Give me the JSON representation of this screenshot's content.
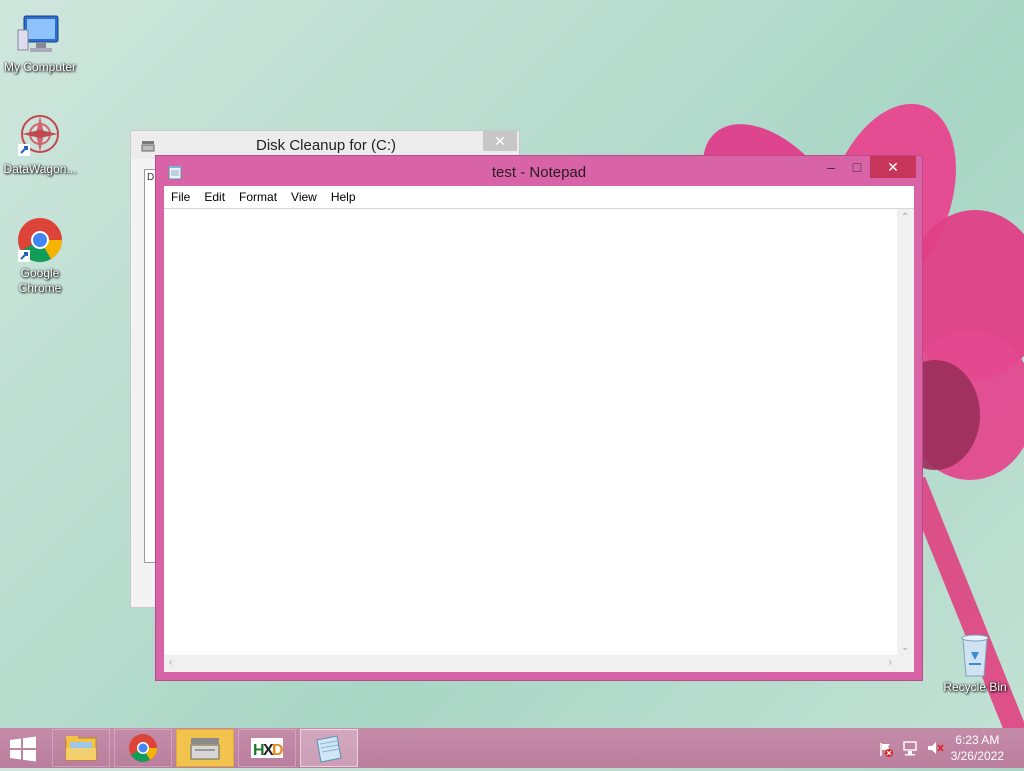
{
  "desktop": {
    "icons": [
      {
        "label": "My Computer",
        "icon": "computer-icon"
      },
      {
        "label": "DataWagon...",
        "icon": "datawagon-icon"
      },
      {
        "label": "Google Chrome",
        "icon": "chrome-icon"
      },
      {
        "label": "Recycle Bin",
        "icon": "recycle-bin-icon"
      }
    ]
  },
  "disk_cleanup": {
    "title": "Disk Cleanup for  (C:)",
    "close_label": "✕",
    "partial_text": "D"
  },
  "notepad": {
    "title": "test - Notepad",
    "minimize_label": "–",
    "maximize_label": "□",
    "close_label": "✕",
    "menu": [
      "File",
      "Edit",
      "Format",
      "View",
      "Help"
    ],
    "content": ""
  },
  "taskbar": {
    "items": [
      {
        "name": "file-explorer",
        "icon": "folder-icon"
      },
      {
        "name": "chrome",
        "icon": "chrome-icon"
      },
      {
        "name": "disk-cleanup",
        "icon": "disk-cleanup-icon",
        "state": "highlighted"
      },
      {
        "name": "hxd",
        "icon": "hxd-icon"
      },
      {
        "name": "notepad",
        "icon": "notepad-icon",
        "state": "active"
      }
    ],
    "tray": {
      "time": "6:23 AM",
      "date": "3/26/2022",
      "icons": [
        "action-center-flag-icon",
        "network-icon",
        "volume-muted-icon"
      ]
    }
  },
  "colors": {
    "accent": "#d863a6",
    "taskbar": "#c68aa8",
    "close": "#c7365a"
  }
}
